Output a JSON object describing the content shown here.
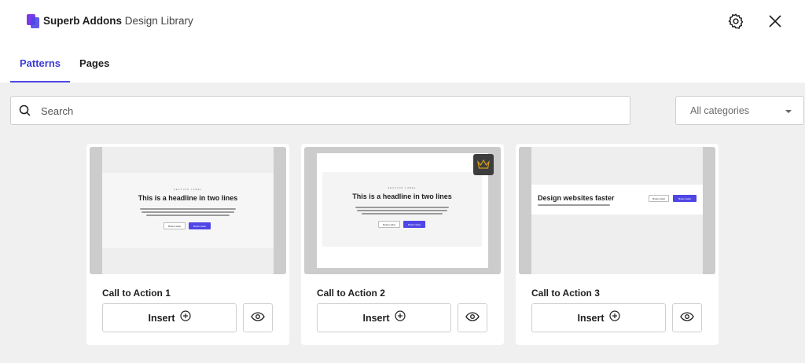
{
  "header": {
    "brand_name": "Superb Addons",
    "brand_sub": "Design Library",
    "icons": [
      "settings-gear-icon",
      "close-icon"
    ]
  },
  "tabs": [
    {
      "label": "Patterns",
      "active": true
    },
    {
      "label": "Pages",
      "active": false
    }
  ],
  "search": {
    "placeholder": "Search",
    "value": ""
  },
  "category_select": {
    "value": "All categories"
  },
  "colors": {
    "accent": "#4f46e5",
    "tab_active": "#3b3bd6",
    "background": "#f0f0f0",
    "premium_badge": "#d4a017"
  },
  "patterns": [
    {
      "title": "Call to Action 1",
      "insert_label": "Insert",
      "premium": false,
      "preview": {
        "eyebrow": "SECTION LABEL",
        "headline": "This is a headline in two lines",
        "button_outline": "Button label",
        "button_filled": "Button label"
      }
    },
    {
      "title": "Call to Action 2",
      "insert_label": "Insert",
      "premium": true,
      "preview": {
        "eyebrow": "SECTION LABEL",
        "headline": "This is a headline in two lines",
        "button_outline": "Button label",
        "button_filled": "Button label"
      }
    },
    {
      "title": "Call to Action 3",
      "insert_label": "Insert",
      "premium": false,
      "preview": {
        "headline": "Design websites faster",
        "button_outline": "Button label",
        "button_filled": "Button label"
      }
    }
  ]
}
